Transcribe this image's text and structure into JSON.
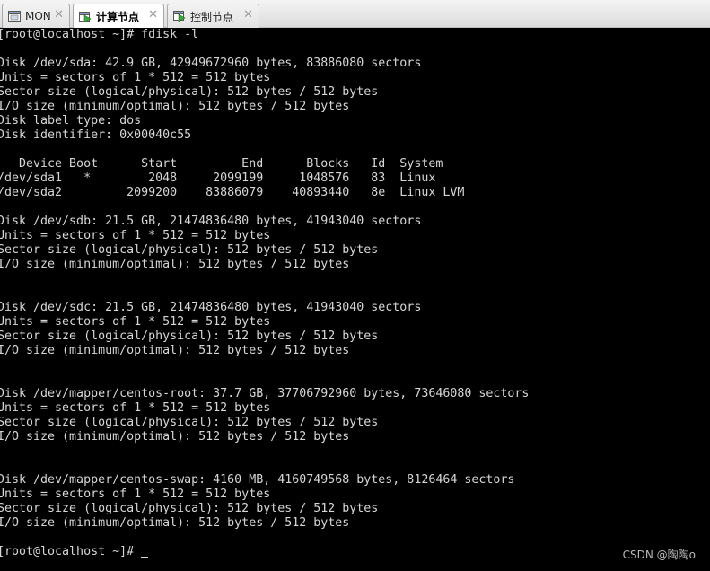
{
  "tabs": [
    {
      "label": "MON",
      "close": "✕",
      "active": false,
      "icon": "vm-window-icon"
    },
    {
      "label": "计算节点",
      "close": "✕",
      "active": true,
      "icon": "vm-running-icon"
    },
    {
      "label": "控制节点",
      "close": "✕",
      "active": false,
      "icon": "vm-running-icon"
    }
  ],
  "terminal": {
    "lines": [
      "[root@localhost ~]# fdisk -l",
      "",
      "Disk /dev/sda: 42.9 GB, 42949672960 bytes, 83886080 sectors",
      "Units = sectors of 1 * 512 = 512 bytes",
      "Sector size (logical/physical): 512 bytes / 512 bytes",
      "I/O size (minimum/optimal): 512 bytes / 512 bytes",
      "Disk label type: dos",
      "Disk identifier: 0x00040c55",
      "",
      "   Device Boot      Start         End      Blocks   Id  System",
      "/dev/sda1   *        2048     2099199     1048576   83  Linux",
      "/dev/sda2         2099200    83886079    40893440   8e  Linux LVM",
      "",
      "Disk /dev/sdb: 21.5 GB, 21474836480 bytes, 41943040 sectors",
      "Units = sectors of 1 * 512 = 512 bytes",
      "Sector size (logical/physical): 512 bytes / 512 bytes",
      "I/O size (minimum/optimal): 512 bytes / 512 bytes",
      "",
      "",
      "Disk /dev/sdc: 21.5 GB, 21474836480 bytes, 41943040 sectors",
      "Units = sectors of 1 * 512 = 512 bytes",
      "Sector size (logical/physical): 512 bytes / 512 bytes",
      "I/O size (minimum/optimal): 512 bytes / 512 bytes",
      "",
      "",
      "Disk /dev/mapper/centos-root: 37.7 GB, 37706792960 bytes, 73646080 sectors",
      "Units = sectors of 1 * 512 = 512 bytes",
      "Sector size (logical/physical): 512 bytes / 512 bytes",
      "I/O size (minimum/optimal): 512 bytes / 512 bytes",
      "",
      "",
      "Disk /dev/mapper/centos-swap: 4160 MB, 4160749568 bytes, 8126464 sectors",
      "Units = sectors of 1 * 512 = 512 bytes",
      "Sector size (logical/physical): 512 bytes / 512 bytes",
      "I/O size (minimum/optimal): 512 bytes / 512 bytes",
      "",
      "[root@localhost ~]# "
    ]
  },
  "watermark": "CSDN @陶陶o",
  "colors": {
    "terminal_bg": "#000000",
    "terminal_fg": "#d6d6d6",
    "vm_icon_green": "#3fa43f"
  }
}
